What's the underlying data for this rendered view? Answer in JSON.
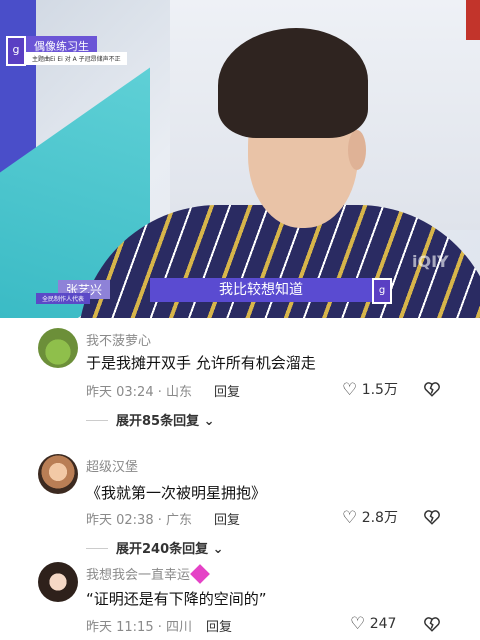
{
  "video": {
    "show_tag": "偶像练习生",
    "show_sub": "主题曲Ei Ei 对 A 子冠昂储声不正",
    "logo_char": "g",
    "name_main": "张艺兴",
    "name_sub": "全民制作人代表",
    "subtitle": "我比较想知道",
    "watermark": "iQIY"
  },
  "comments": [
    {
      "username": "我不菠萝心",
      "text": "于是我摊开双手 允许所有机会溜走",
      "time": "昨天 03:24 · 山东",
      "reply_label": "回复",
      "likes": "1.5万",
      "expand": "展开85条回复"
    },
    {
      "username": "超级汉堡",
      "text": "《我就第一次被明星拥抱》",
      "time": "昨天 02:38 · 广东",
      "reply_label": "回复",
      "likes": "2.8万",
      "expand": "展开240条回复"
    },
    {
      "username": "我想我会一直幸运",
      "text": "“证明还是有下降的空间的”",
      "time": "昨天 11:15 · 四川",
      "reply_label": "回复",
      "likes": "247"
    }
  ],
  "icons": {
    "like": "heart-outline-icon",
    "dislike": "heart-broken-icon",
    "expand_chevron": "chevron-down-icon"
  }
}
